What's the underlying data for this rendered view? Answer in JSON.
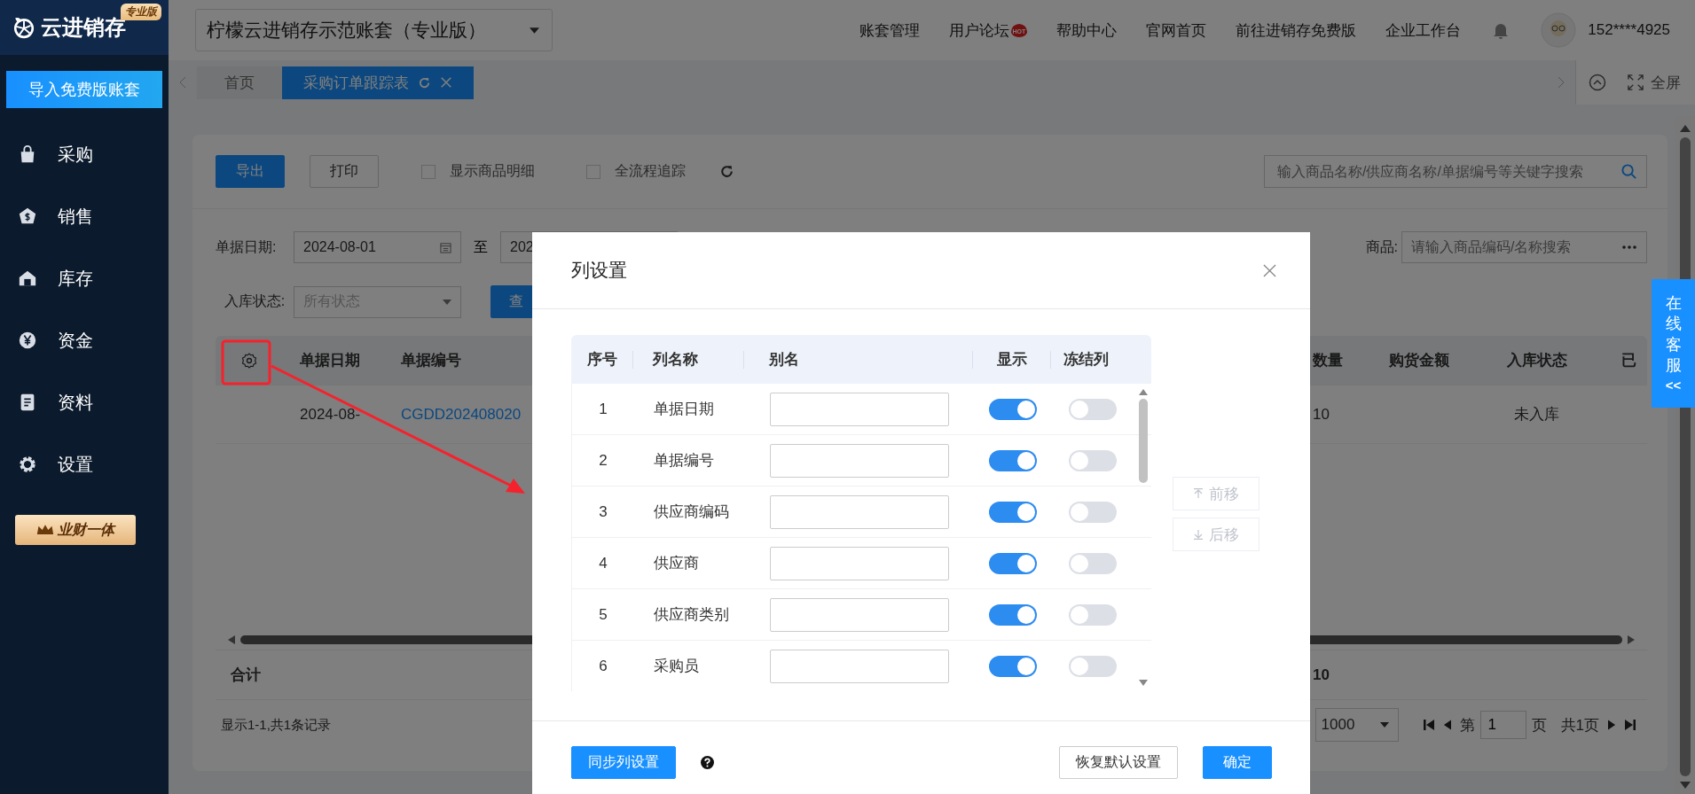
{
  "sidebar": {
    "logo_text": "云进销存",
    "edition_badge": "专业版",
    "import_button": "导入免费版账套",
    "menu": [
      {
        "label": "采购"
      },
      {
        "label": "销售"
      },
      {
        "label": "库存"
      },
      {
        "label": "资金"
      },
      {
        "label": "资料"
      },
      {
        "label": "设置"
      }
    ],
    "promo_badge": "业财一体"
  },
  "header": {
    "account_selector": "柠檬云进销存示范账套（专业版）",
    "nav_links": [
      {
        "label": "账套管理"
      },
      {
        "label": "用户论坛",
        "badge": "HOT"
      },
      {
        "label": "帮助中心"
      },
      {
        "label": "官网首页"
      },
      {
        "label": "前往进销存免费版"
      },
      {
        "label": "企业工作台"
      }
    ],
    "user_name": "152****4925"
  },
  "tabs": {
    "items": [
      {
        "label": "首页",
        "selected": false
      },
      {
        "label": "采购订单跟踪表",
        "selected": true
      }
    ],
    "fullscreen": "全屏"
  },
  "toolbar": {
    "buttons": [
      {
        "label": "导出",
        "kind": "primary"
      },
      {
        "label": "打印",
        "kind": "default"
      }
    ],
    "checkboxes": [
      {
        "label": "显示商品明细",
        "checked": false
      },
      {
        "label": "全流程追踪",
        "checked": false
      }
    ],
    "search_placeholder": "输入商品名称/供应商名称/单据编号等关键字搜索"
  },
  "filters": {
    "date_label": "单据日期:",
    "date_from": "2024-08-01",
    "date_sep": "至",
    "date_to": "202",
    "goods_label": "商品:",
    "goods_placeholder": "请输入商品编码/名称搜索",
    "status_label": "入库状态:",
    "status_placeholder": "所有状态",
    "query_button": "查"
  },
  "table": {
    "left_columns": [
      "单据日期",
      "单据编号"
    ],
    "right_columns": [
      "数量",
      "购货金额",
      "入库状态",
      "已"
    ],
    "rows": [
      {
        "left": [
          "2024-08-",
          "CGDD202408020"
        ],
        "quantity": "10",
        "status": "未入库"
      }
    ],
    "total_label": "合计",
    "total_quantity": "10"
  },
  "pagination": {
    "summary": "显示1-1,共1条记录",
    "page_size": "1000",
    "page_prefix": "第",
    "page": "1",
    "page_suffix": "页",
    "total_pages": "共1页"
  },
  "modal": {
    "title": "列设置",
    "columns": [
      "序号",
      "列名称",
      "别名",
      "显示",
      "冻结列"
    ],
    "rows": [
      {
        "index": "1",
        "name": "单据日期",
        "visible": true,
        "frozen": false
      },
      {
        "index": "2",
        "name": "单据编号",
        "visible": true,
        "frozen": false
      },
      {
        "index": "3",
        "name": "供应商编码",
        "visible": true,
        "frozen": false
      },
      {
        "index": "4",
        "name": "供应商",
        "visible": true,
        "frozen": false
      },
      {
        "index": "5",
        "name": "供应商类别",
        "visible": true,
        "frozen": false
      },
      {
        "index": "6",
        "name": "采购员",
        "visible": true,
        "frozen": false
      }
    ],
    "move_buttons": [
      {
        "label": "前移",
        "disabled": true
      },
      {
        "label": "后移",
        "disabled": true
      }
    ],
    "sync_button": "同步列设置",
    "reset_button": "恢复默认设置",
    "confirm_button": "确定"
  },
  "service_tab": {
    "label": "在线客服",
    "arrows": "<<"
  }
}
